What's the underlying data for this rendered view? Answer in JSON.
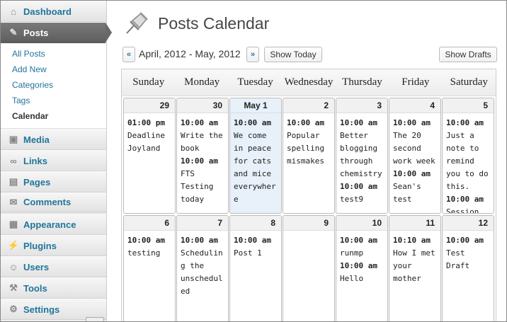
{
  "sidebar": {
    "dashboard": {
      "label": "Dashboard",
      "icon": "dashboard-icon"
    },
    "posts": {
      "label": "Posts",
      "icon": "pin-icon"
    },
    "submenu": [
      "All Posts",
      "Add New",
      "Categories",
      "Tags",
      "Calendar"
    ],
    "items": [
      {
        "label": "Media",
        "icon": "media-icon"
      },
      {
        "label": "Links",
        "icon": "links-icon"
      },
      {
        "label": "Pages",
        "icon": "pages-icon"
      },
      {
        "label": "Comments",
        "icon": "comments-icon"
      },
      {
        "label": "Appearance",
        "icon": "appearance-icon"
      },
      {
        "label": "Plugins",
        "icon": "plugins-icon"
      },
      {
        "label": "Users",
        "icon": "users-icon"
      },
      {
        "label": "Tools",
        "icon": "tools-icon"
      },
      {
        "label": "Settings",
        "icon": "settings-icon"
      }
    ]
  },
  "header": {
    "title": "Posts Calendar"
  },
  "nav": {
    "prev_label": "«",
    "range": "April, 2012 - May, 2012",
    "next_label": "»",
    "show_today": "Show Today",
    "show_drafts": "Show Drafts"
  },
  "calendar": {
    "weekdays": [
      "Sunday",
      "Monday",
      "Tuesday",
      "Wednesday",
      "Thursday",
      "Friday",
      "Saturday"
    ],
    "weeks": [
      [
        {
          "num": "29",
          "posts": [
            {
              "time": "01:00 pm",
              "title": "Deadline Joyland"
            }
          ]
        },
        {
          "num": "30",
          "posts": [
            {
              "time": "10:00 am",
              "title": "Write the book"
            },
            {
              "time": "10:00 am",
              "title": "FTS Testing today"
            }
          ]
        },
        {
          "num": "May 1",
          "today": true,
          "posts": [
            {
              "time": "10:00 am",
              "title": "We come in peace for cats and mice everywhere"
            }
          ]
        },
        {
          "num": "2",
          "posts": [
            {
              "time": "10:00 am",
              "title": "Popular spelling mismakes"
            }
          ]
        },
        {
          "num": "3",
          "posts": [
            {
              "time": "10:00 am",
              "title": "Better blogging through chemistry"
            },
            {
              "time": "10:00 am",
              "title": "test9"
            }
          ]
        },
        {
          "num": "4",
          "posts": [
            {
              "time": "10:00 am",
              "title": "The 20 second work week"
            },
            {
              "time": "10:00 am",
              "title": "Sean's test"
            }
          ]
        },
        {
          "num": "5",
          "posts": [
            {
              "time": "10:00 am",
              "title": "Just a note to remind you to do this."
            },
            {
              "time": "10:00 am",
              "title": "Session"
            }
          ]
        }
      ],
      [
        {
          "num": "6",
          "posts": [
            {
              "time": "10:00 am",
              "title": "testing"
            }
          ]
        },
        {
          "num": "7",
          "posts": [
            {
              "time": "10:00 am",
              "title": "Scheduling the unscheduled"
            }
          ]
        },
        {
          "num": "8",
          "posts": [
            {
              "time": "10:00 am",
              "title": "Post 1"
            }
          ]
        },
        {
          "num": "9",
          "posts": []
        },
        {
          "num": "10",
          "posts": [
            {
              "time": "10:00 am",
              "title": "runmp"
            },
            {
              "time": "10:00 am",
              "title": "Hello"
            }
          ]
        },
        {
          "num": "11",
          "posts": [
            {
              "time": "10:10 am",
              "title": "How I met your mother"
            }
          ]
        },
        {
          "num": "12",
          "posts": [
            {
              "time": "10:00 am",
              "title": "Test Draft"
            }
          ]
        }
      ]
    ]
  },
  "colors": {
    "link": "#21759b",
    "active_menu": "#666666",
    "today_bg": "#e8f0fa"
  }
}
